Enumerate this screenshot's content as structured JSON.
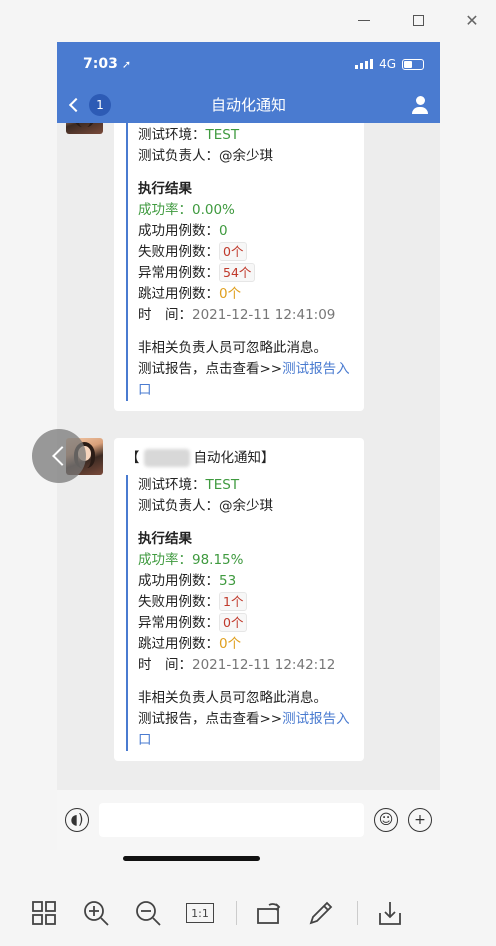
{
  "window": {
    "minimize_label": "",
    "close_glyph": "✕"
  },
  "phone": {
    "status": {
      "time": "7:03",
      "network": "4G"
    },
    "nav": {
      "back_badge": "1",
      "title": "自动化通知"
    },
    "messages": [
      {
        "header_prefix": "",
        "header_suffix": "",
        "env_label": "测试环境：",
        "env_value": "TEST",
        "owner_label": "测试负责人：",
        "owner_value": "@余少琪",
        "result_title": "执行结果",
        "rate_label": "成功率：",
        "rate_value": "0.00%",
        "success_label": "成功用例数：",
        "success_value": "0",
        "fail_label": "失败用例数：",
        "fail_value": "0个",
        "error_label": "异常用例数：",
        "error_value": "54个",
        "skip_label": "跳过用例数：",
        "skip_value": "0个",
        "time_label": "时　间：",
        "time_value": "2021-12-11 12:41:09",
        "notice": "非相关负责人员可忽略此消息。",
        "report_prefix": "测试报告，点击查看>>",
        "report_link": "测试报告入口"
      },
      {
        "header_prefix": "【",
        "header_suffix": "自动化通知】",
        "env_label": "测试环境：",
        "env_value": "TEST",
        "owner_label": "测试负责人：",
        "owner_value": "@余少琪",
        "result_title": "执行结果",
        "rate_label": "成功率：",
        "rate_value": "98.15%",
        "success_label": "成功用例数：",
        "success_value": "53",
        "fail_label": "失败用例数：",
        "fail_value": "1个",
        "error_label": "异常用例数：",
        "error_value": "0个",
        "skip_label": "跳过用例数：",
        "skip_value": "0个",
        "time_label": "时　间：",
        "time_value": "2021-12-11 12:42:12",
        "notice": "非相关负责人员可忽略此消息。",
        "report_prefix": "测试报告，点击查看>>",
        "report_link": "测试报告入口"
      }
    ]
  },
  "toolbar": {
    "items": [
      "grid-icon",
      "zoom-in-icon",
      "zoom-out-icon",
      "actual-size-icon",
      "rotate-icon",
      "edit-icon",
      "download-icon"
    ],
    "actual_size_label": "1:1"
  },
  "colors": {
    "brand": "#4a7bd0",
    "success_green": "#3f9a3f",
    "warn_orange": "#e0a020",
    "error_red": "#c0392b"
  }
}
